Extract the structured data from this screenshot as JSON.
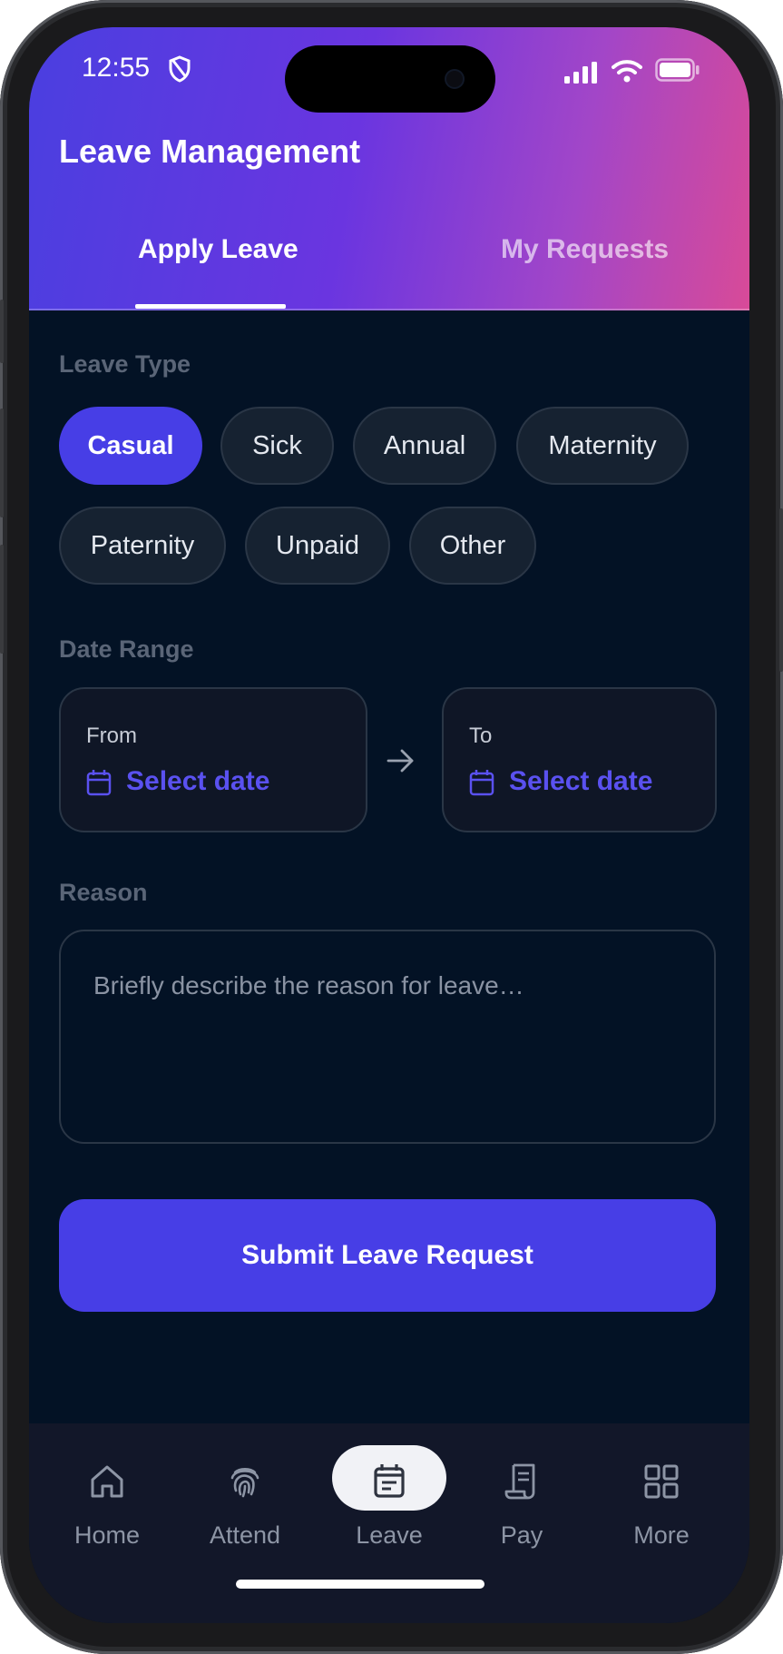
{
  "status": {
    "time": "12:55"
  },
  "app": {
    "title": "Leave Management"
  },
  "tabs": [
    {
      "label": "Apply Leave"
    },
    {
      "label": "My Requests"
    }
  ],
  "leave_type": {
    "label": "Leave Type",
    "options": [
      "Casual",
      "Sick",
      "Annual",
      "Maternity",
      "Paternity",
      "Unpaid",
      "Other"
    ],
    "selected": "Casual"
  },
  "date_range": {
    "label": "Date Range",
    "from": {
      "label": "From",
      "value": "Select date"
    },
    "to": {
      "label": "To",
      "value": "Select date"
    }
  },
  "reason": {
    "label": "Reason",
    "placeholder": "Briefly describe the reason for leave…"
  },
  "submit": {
    "label": "Submit Leave Request"
  },
  "nav": {
    "items": [
      {
        "label": "Home",
        "icon": "home-icon"
      },
      {
        "label": "Attend",
        "icon": "fingerprint-icon"
      },
      {
        "label": "Leave",
        "icon": "calendar-icon"
      },
      {
        "label": "Pay",
        "icon": "receipt-icon"
      },
      {
        "label": "More",
        "icon": "grid-icon"
      }
    ],
    "active": "Leave"
  },
  "colors": {
    "accent": "#473ee6",
    "background": "#031225",
    "header_start": "#4a3fe0",
    "header_end": "#d84a98"
  }
}
